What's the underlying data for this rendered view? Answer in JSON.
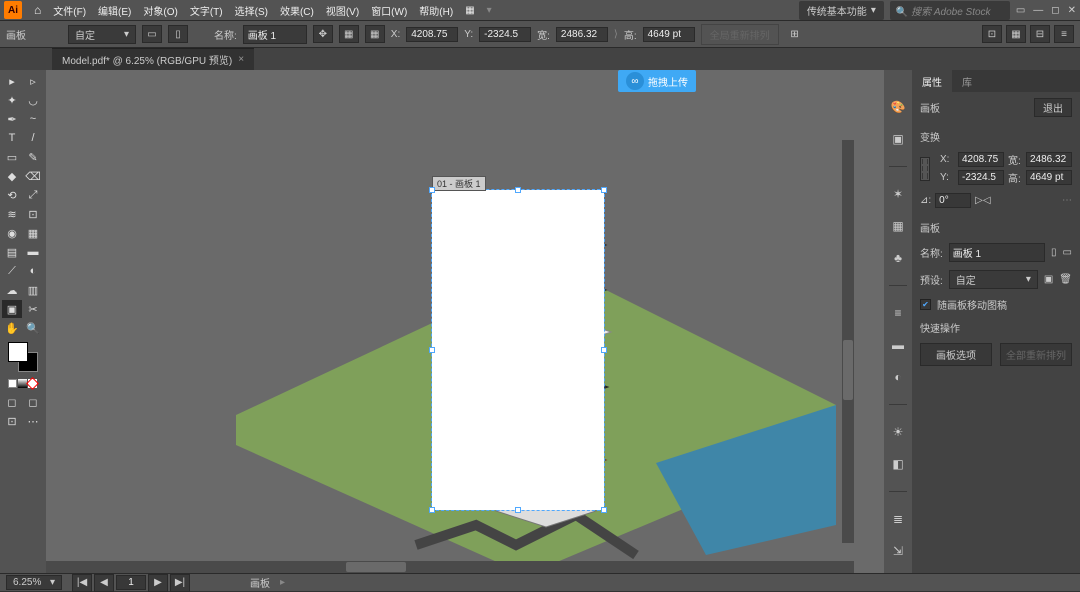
{
  "menubar": {
    "logo": "Ai",
    "items": [
      "文件(F)",
      "编辑(E)",
      "对象(O)",
      "文字(T)",
      "选择(S)",
      "效果(C)",
      "视图(V)",
      "窗口(W)",
      "帮助(H)"
    ],
    "extra_icon": "▦",
    "workspace": "传统基本功能",
    "search_placeholder": "搜索 Adobe Stock"
  },
  "controlbar": {
    "left_label": "画板",
    "preset": "自定",
    "orient_icons": [
      "▭",
      "▯"
    ],
    "name_label": "名称:",
    "artboard_name": "画板 1",
    "coords": {
      "xl": "X:",
      "x": "4208.75",
      "yl": "Y:",
      "y": "-2324.5",
      "wl": "宽:",
      "w": "2486.32",
      "hl": "高:",
      "h": "4649 pt"
    },
    "ghost": "全局重新排列"
  },
  "tab": {
    "title": "Model.pdf* @ 6.25% (RGB/GPU 预览)"
  },
  "upload_badge": "拖拽上传",
  "artboard_label": "01 - 画板 1",
  "right_tabs": {
    "props": "属性",
    "libs": "库"
  },
  "props": {
    "title": "画板",
    "exit": "退出",
    "sect_transform": "变换",
    "x": "4208.75",
    "y": "-2324.5",
    "w": "2486.32",
    "h": "4649 pt",
    "angle_label": "⊿:",
    "angle": "0°",
    "sect_artboard": "画板",
    "name_label": "名称:",
    "name": "画板 1",
    "preset_label": "预设:",
    "preset": "自定",
    "checkbox": "随画板移动图稿",
    "quick_title": "快速操作",
    "btn_opts": "画板选项",
    "btn_rearr": "全部重新排列"
  },
  "footer": {
    "zoom": "6.25%",
    "nav": [
      "|◀",
      "◀",
      "1",
      "▶",
      "▶|"
    ],
    "label": "画板"
  }
}
